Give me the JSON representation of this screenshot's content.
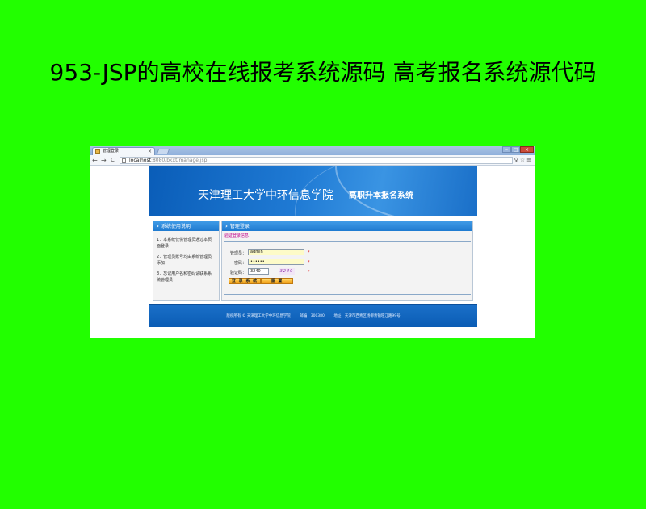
{
  "page": {
    "title": "953-JSP的高校在线报考系统源码 高考报名系统源代码"
  },
  "browser": {
    "tab_title": "管理登录",
    "tab_close": "×",
    "url_host": "localhost",
    "url_path": ":8080/bkxt/manage.jsp",
    "nav": {
      "back": "←",
      "forward": "→",
      "reload": "C"
    },
    "tools": "♀☆≡",
    "window_buttons": {
      "minimize": "–",
      "maximize": "□",
      "close": "×"
    }
  },
  "site": {
    "school_name": "天津理工大学中环信息学院",
    "system_name": "高职升本报名系统",
    "left_panel": {
      "title": "系统使用说明",
      "notes": [
        "1．本系统仅供管理员通过本页面登录！",
        "2．管理员账号均由系统管理员添加！",
        "3．忘记用户名和密码请联系系统管理员！"
      ]
    },
    "login": {
      "title": "管理登录",
      "tip": "验证登录信息：",
      "username_label": "管理员：",
      "username_value": "admin",
      "password_label": "密码：",
      "password_value": "••••••",
      "captcha_label": "验证码：",
      "captcha_value": "3240",
      "captcha_image_text": "3240",
      "required_mark": "*",
      "submit_label": "登 录 系 统",
      "reset_label": "重 置"
    },
    "footer": {
      "copyright": "版权所有 © 天津理工大学中环信息学院",
      "postcode": "邮编：300380",
      "address": "地址：天津市西青区杨柳青镇旺江路99号"
    }
  },
  "colors": {
    "background": "#22ff00",
    "banner": "#1f7ad4",
    "panel_header": "#2f8ae0",
    "button": "#f2a21a"
  }
}
